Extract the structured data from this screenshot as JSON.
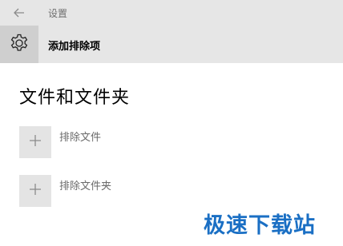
{
  "window": {
    "title": "设置",
    "back_icon": "back-arrow-icon"
  },
  "header": {
    "icon": "gear-icon",
    "title": "添加排除项"
  },
  "main": {
    "section_title": "文件和文件夹",
    "items": [
      {
        "icon": "plus-icon",
        "label": "排除文件"
      },
      {
        "icon": "plus-icon",
        "label": "排除文件夹"
      }
    ]
  },
  "watermark": {
    "text": "极速下载站"
  },
  "colors": {
    "chrome": "#e6e6e6",
    "gear_box": "#cfcfcf",
    "plus_box": "#e4e4e4",
    "watermark": "#1a6fc4"
  }
}
